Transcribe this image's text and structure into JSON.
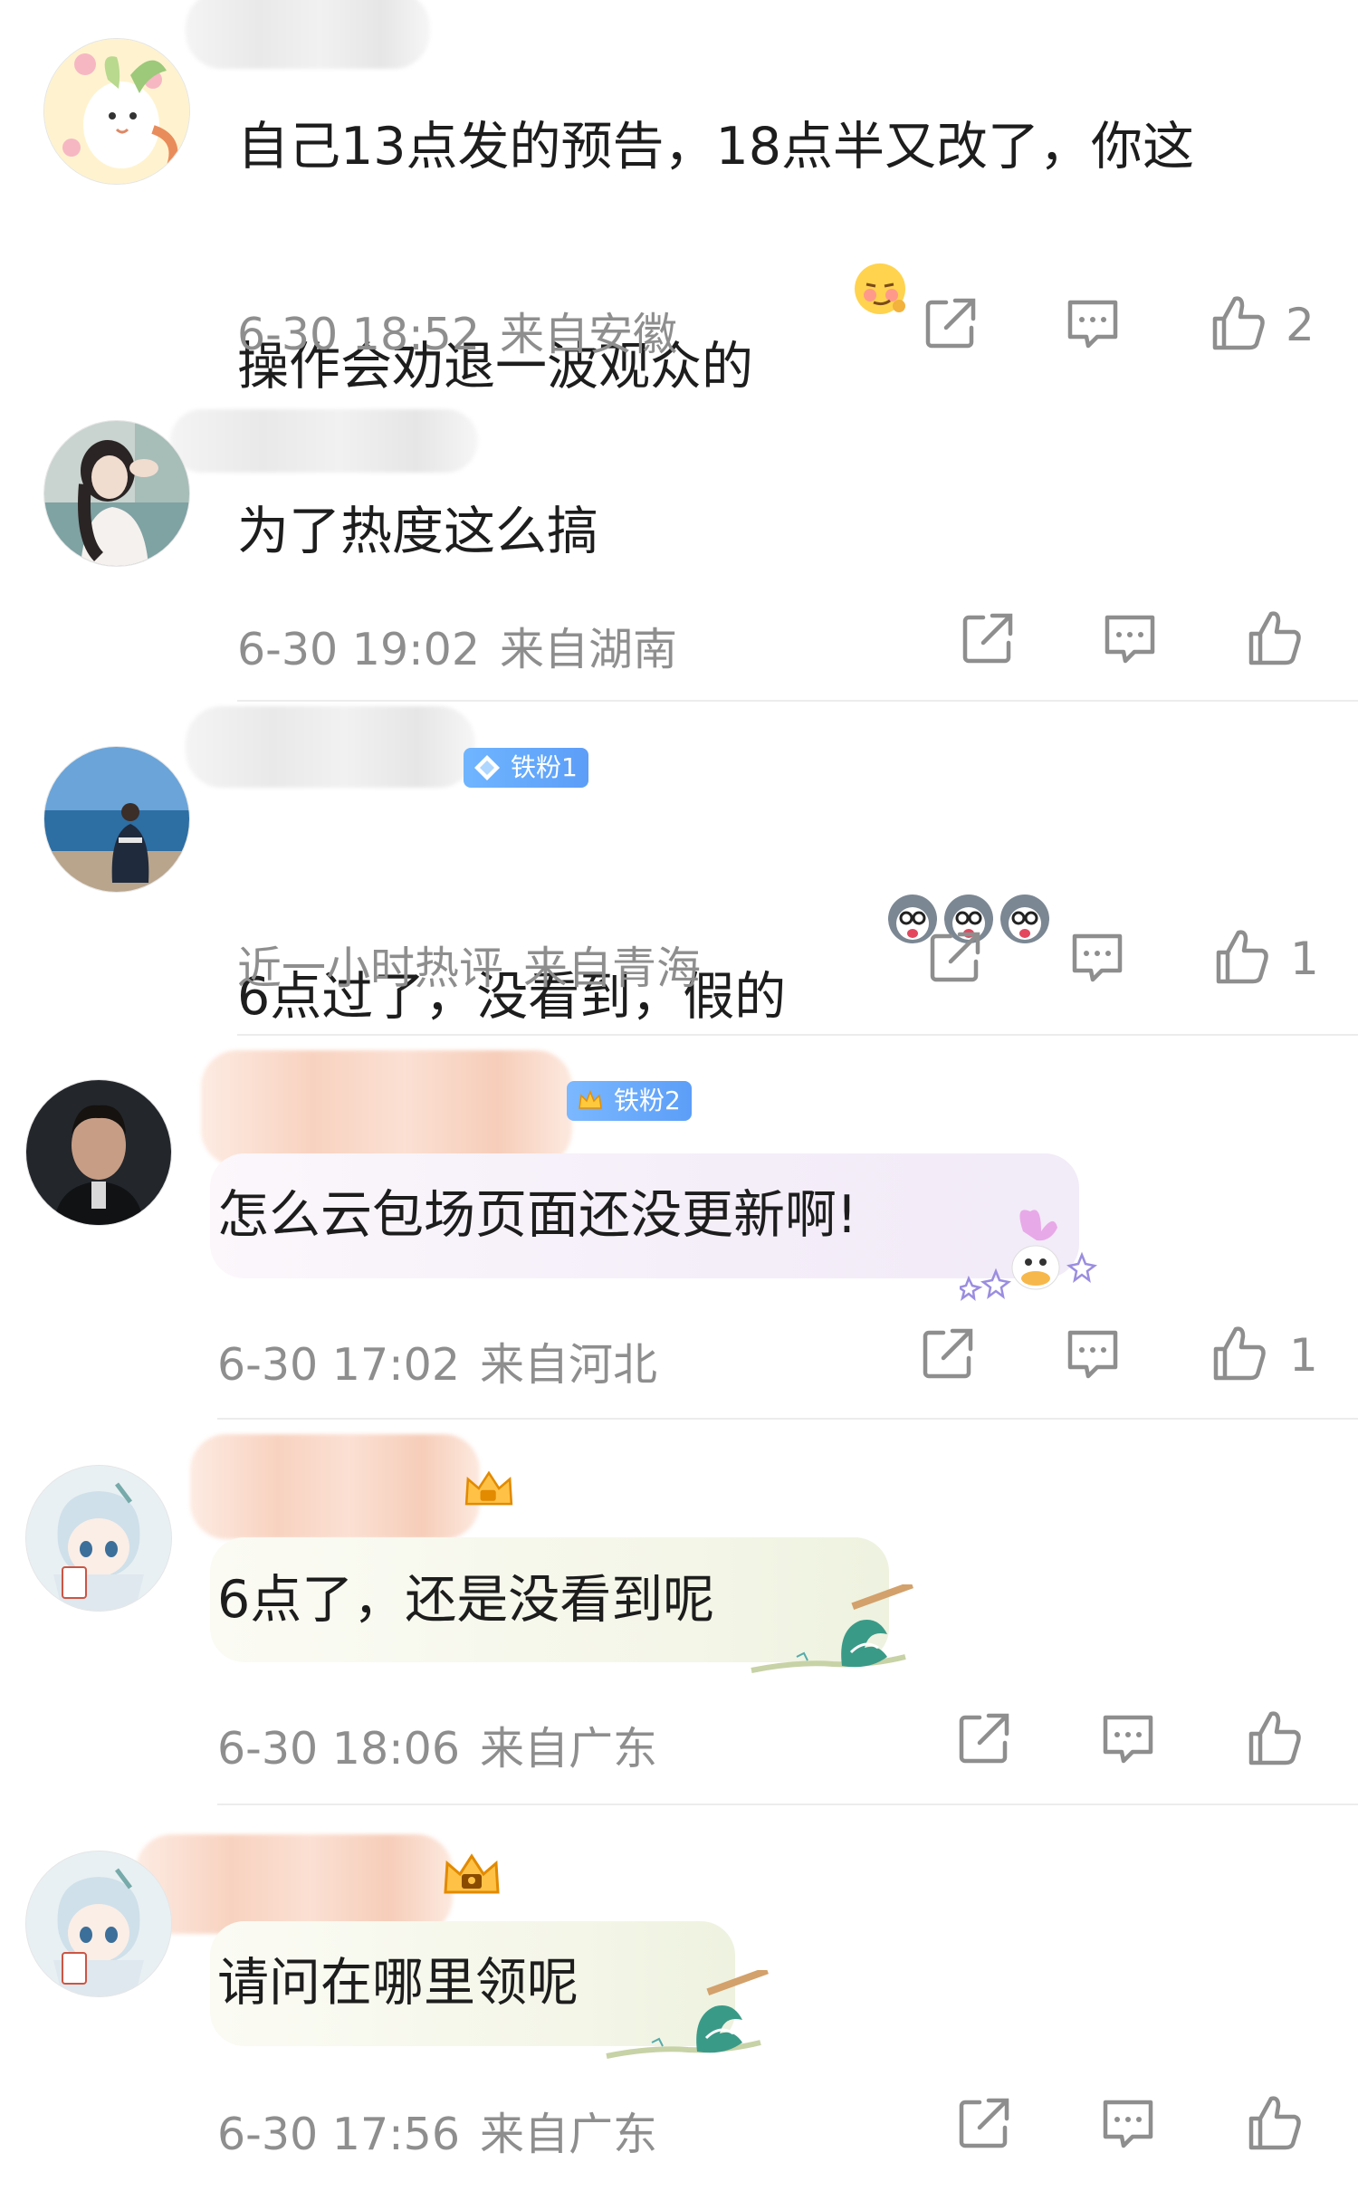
{
  "comments": [
    {
      "text": "自己13点发的预告，18点半又改了，你这\n操作会劝退一波观众的",
      "emoji": "smirk-emoji",
      "time": "6-30 18:52",
      "location": "来自安徽",
      "likes": "2"
    },
    {
      "text": "为了热度这么搞",
      "time": "6-30 19:02",
      "location": "来自湖南",
      "likes": ""
    },
    {
      "badge": "铁粉1",
      "text": "6点过了，没看到，假的",
      "emoji": "husky-emoji",
      "time": "近一小时热评",
      "location": "来自青海",
      "likes": "1"
    },
    {
      "badge": "铁粉2",
      "text": "怎么云包场页面还没更新啊!",
      "time": "6-30 17:02",
      "location": "来自河北",
      "likes": "1"
    },
    {
      "text": "6点了，还是没看到呢",
      "time": "6-30 18:06",
      "location": "来自广东",
      "likes": ""
    },
    {
      "text": "请问在哪里领呢",
      "time": "6-30 17:56",
      "location": "来自广东",
      "likes": ""
    }
  ],
  "icons": {
    "share": "share-icon",
    "reply": "comment-icon",
    "like": "thumbs-up-icon"
  },
  "colors": {
    "meta_gray": "#8e8e8e",
    "badge_blue": "#5c9ef8",
    "divider": "#ececec"
  }
}
